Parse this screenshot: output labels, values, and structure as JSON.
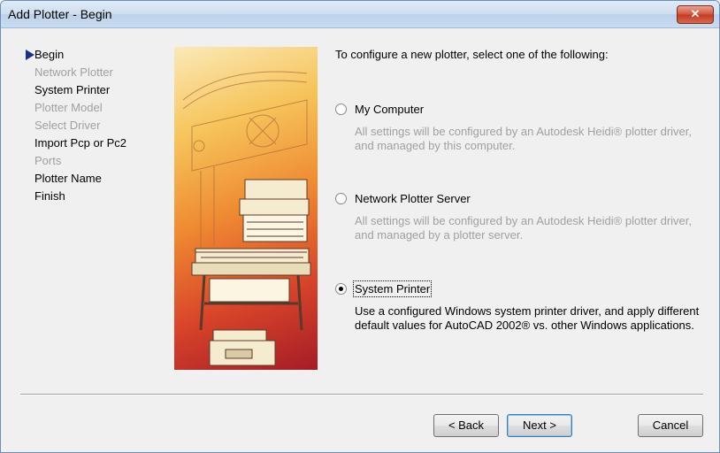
{
  "window": {
    "title": "Add Plotter - Begin",
    "close_label": "✕"
  },
  "steps": [
    {
      "label": "Begin",
      "state": "current"
    },
    {
      "label": "Network Plotter",
      "state": "disabled"
    },
    {
      "label": "System Printer",
      "state": "enabled"
    },
    {
      "label": "Plotter Model",
      "state": "disabled"
    },
    {
      "label": "Select Driver",
      "state": "disabled"
    },
    {
      "label": "Import Pcp or Pc2",
      "state": "enabled"
    },
    {
      "label": "Ports",
      "state": "disabled"
    },
    {
      "label": "Plotter Name",
      "state": "enabled"
    },
    {
      "label": "Finish",
      "state": "enabled"
    }
  ],
  "main": {
    "instruction": "To configure a new plotter, select one of the following:",
    "options": [
      {
        "label": "My Computer",
        "checked": false,
        "description": "All settings will be configured by an Autodesk Heidi® plotter driver, and managed by this computer."
      },
      {
        "label": "Network Plotter Server",
        "checked": false,
        "description": "All settings will be configured by an Autodesk Heidi® plotter driver, and managed by a plotter server."
      },
      {
        "label": "System Printer",
        "checked": true,
        "description": "Use a configured Windows system printer driver, and apply different default values for AutoCAD 2002® vs. other Windows applications."
      }
    ]
  },
  "buttons": {
    "back": "< Back",
    "next": "Next >",
    "cancel": "Cancel"
  }
}
